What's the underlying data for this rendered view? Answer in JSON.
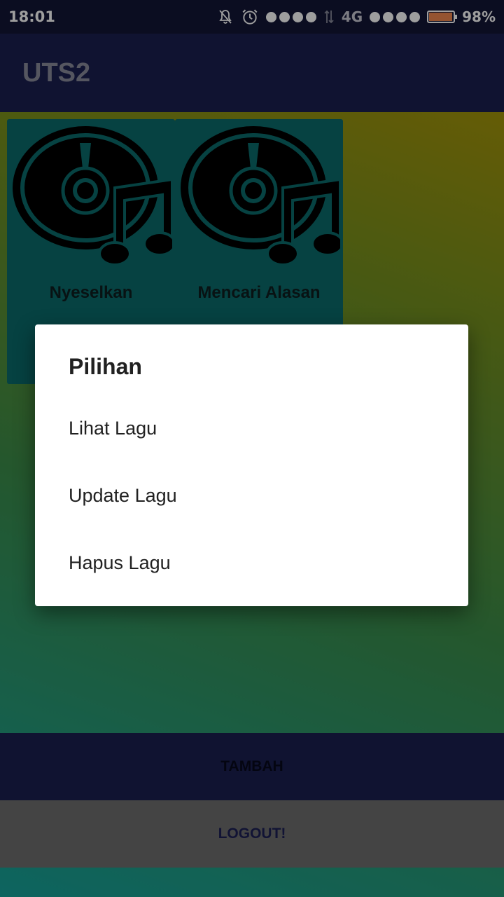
{
  "status_bar": {
    "time": "18:01",
    "network": "4G",
    "battery": "98%",
    "battery_level": 0.98,
    "icons": [
      "bell-off-icon",
      "alarm-icon",
      "signal-dots-icon",
      "data-arrows-icon",
      "battery-icon"
    ]
  },
  "app_bar": {
    "title": "UTS2"
  },
  "songs": [
    {
      "title": "Nyeselkan",
      "icon": "music-disc-icon"
    },
    {
      "title": "Mencari Alasan",
      "icon": "music-disc-icon"
    }
  ],
  "buttons": {
    "add": "TAMBAH",
    "logout": "LOGOUT!"
  },
  "dialog": {
    "title": "Pilihan",
    "options": [
      "Lihat Lagu",
      "Update Lagu",
      "Hapus Lagu"
    ]
  },
  "colors": {
    "app_bar": "#1b2050",
    "card": "#0b6b6b",
    "battery": "#f0884f",
    "logout_bg": "#6f6f6f"
  }
}
